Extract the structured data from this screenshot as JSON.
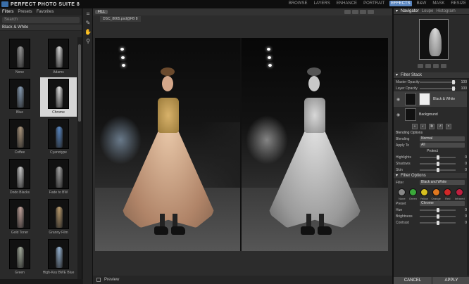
{
  "app": {
    "brand": "PERFECT PHOTO SUITE 8",
    "modules": [
      "BROWSE",
      "LAYERS",
      "ENHANCE",
      "PORTRAIT",
      "EFFECTS",
      "B&W",
      "MASK",
      "RESIZE"
    ],
    "active_module": "EFFECTS"
  },
  "left_panel": {
    "tabs": [
      "Filters",
      "Presets",
      "Favorites"
    ],
    "active_tab": "Filters",
    "search_placeholder": "Search",
    "category": "Black & White",
    "presets": [
      {
        "name": "None",
        "tone": "#9a9a9a"
      },
      {
        "name": "Adams",
        "tone": "#dcdcdc"
      },
      {
        "name": "Blue",
        "tone": "#8aa0b8"
      },
      {
        "name": "Chrome",
        "tone": "#e6e6e6"
      },
      {
        "name": "Coffee",
        "tone": "#b09a80"
      },
      {
        "name": "Cyanotype",
        "tone": "#5a8ac8"
      },
      {
        "name": "Dodo Blacks",
        "tone": "#cfcfcf"
      },
      {
        "name": "Fade to BW",
        "tone": "#a8a8a8"
      },
      {
        "name": "Gold Toner",
        "tone": "#c8a8a0"
      },
      {
        "name": "Granny Film",
        "tone": "#c0a070"
      },
      {
        "name": "Green",
        "tone": "#a8b0a0"
      },
      {
        "name": "High-Key BWE Blue",
        "tone": "#9ab8d8"
      }
    ],
    "selected_preset": "Chrome"
  },
  "canvas": {
    "zoom": "FILL",
    "file_tab": "DSC_8065.psd@FB 8",
    "preview_label": "Preview"
  },
  "right_panel": {
    "navigator_tabs": [
      "Navigator",
      "Loupe",
      "Histogram"
    ],
    "filter_stack_title": "Filter Stack",
    "stack_rows": [
      {
        "label": "Master Opacity",
        "value": "100",
        "level": 0.95
      },
      {
        "label": "Layer Opacity",
        "value": "100",
        "level": 0.95
      }
    ],
    "layers": [
      {
        "name": "Black & White",
        "selected": true
      },
      {
        "name": "Background",
        "selected": false
      }
    ],
    "blending_title": "Blending Options",
    "blending_mode_label": "Blending",
    "blending_mode": "Normal",
    "apply_to_label": "Apply To",
    "apply_to": "All",
    "protect_title": "Protect",
    "protect_rows": [
      {
        "label": "Highlights",
        "value": "0",
        "level": 0.5
      },
      {
        "label": "Shadows",
        "value": "0",
        "level": 0.5
      },
      {
        "label": "Skin",
        "value": "0",
        "level": 0.5
      }
    ],
    "filter_options_title": "Filter Options",
    "filter_label": "Filter",
    "filter_value": "Black and White",
    "color_filters": [
      {
        "name": "None",
        "color": "#888888"
      },
      {
        "name": "Green",
        "color": "#3aa83a"
      },
      {
        "name": "Yellow",
        "color": "#d8c020"
      },
      {
        "name": "Orange",
        "color": "#e07820"
      },
      {
        "name": "Red",
        "color": "#d02828"
      },
      {
        "name": "Infrared",
        "color": "#c02040"
      }
    ],
    "preset_label": "Preset",
    "preset_value": "Chrome",
    "option_rows": [
      {
        "label": "Hue",
        "value": "0",
        "level": 0.5
      },
      {
        "label": "Brightness",
        "value": "0",
        "level": 0.5
      },
      {
        "label": "Contrast",
        "value": "0",
        "level": 0.5
      }
    ],
    "cancel_label": "CANCEL",
    "apply_label": "APPLY"
  }
}
